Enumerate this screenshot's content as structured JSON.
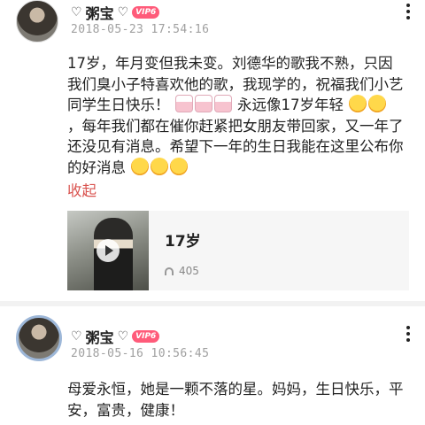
{
  "posts": [
    {
      "username": "粥宝",
      "vip_badge": "VIP6",
      "timestamp": "2018-05-23 17:54:16",
      "text_parts": [
        "17岁，年月变但我未变。刘德华的歌我不熟，只因我们臭小子特喜欢他的歌，我现学的，祝福我们小艺同学生日快乐！",
        "永远像17岁年轻",
        "，每年我们都在催你赶紧把女朋友带回家，又一年了还没见有消息。希望下一年的生日我能在这里公布你的好消息"
      ],
      "collapse_label": "收起",
      "song": {
        "title": "17岁",
        "plays": "405"
      }
    },
    {
      "username": "粥宝",
      "vip_badge": "VIP6",
      "timestamp": "2018-05-16 10:56:45",
      "text": "母爱永恒，她是一颗不落的星。妈妈，生日快乐，平安，富贵，健康！"
    }
  ],
  "icons": {
    "heart": "♡",
    "crown": "♛",
    "emoji_grin": "😁",
    "emoji_shush": "🤫",
    "cake": "🎂"
  },
  "colors": {
    "vip": "#ff5b7a",
    "collapse": "#d9534f",
    "timestamp": "#a0a0a0"
  }
}
